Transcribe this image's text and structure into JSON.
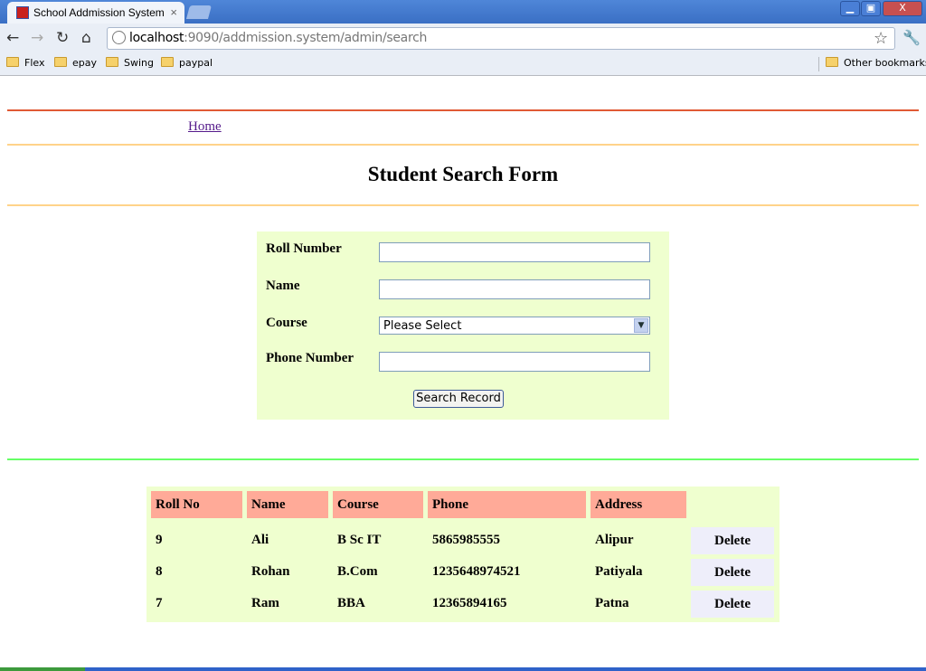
{
  "browser": {
    "tab_title": "School Addmission System",
    "tab_close": "×",
    "url_host": "localhost",
    "url_rest": ":9090/addmission.system/admin/search",
    "window_controls": {
      "minimize": "▁",
      "maximize": "▣",
      "close": "X"
    },
    "bookmarks": [
      "Flex",
      "epay",
      "Swing",
      "paypal"
    ],
    "other_bookmarks": "Other bookmarks"
  },
  "nav": {
    "home": "Home"
  },
  "page": {
    "title": "Student Search Form"
  },
  "form": {
    "roll_label": "Roll Number",
    "name_label": "Name",
    "course_label": "Course",
    "course_selected": "Please Select",
    "phone_label": "Phone Number",
    "submit_label": "Search Record"
  },
  "table": {
    "headers": [
      "Roll No",
      "Name",
      "Course",
      "Phone",
      "Address"
    ],
    "rows": [
      {
        "roll": "9",
        "name": "Ali",
        "course": "B Sc IT",
        "phone": "5865985555",
        "address": "Alipur",
        "action": "Delete"
      },
      {
        "roll": "8",
        "name": "Rohan",
        "course": "B.Com",
        "phone": "1235648974521",
        "address": "Patiyala",
        "action": "Delete"
      },
      {
        "roll": "7",
        "name": "Ram",
        "course": "BBA",
        "phone": "12365894165",
        "address": "Patna",
        "action": "Delete"
      }
    ]
  },
  "colors": {
    "accent_red": "#e05a35",
    "rule_orange": "#ffd38a",
    "rule_green": "#66ff66",
    "panel_bg": "#efffcf",
    "header_bg": "#ffaa98"
  },
  "icons": [
    "back-arrow-icon",
    "forward-arrow-icon",
    "reload-icon",
    "home-icon",
    "page-info-icon",
    "bookmark-star-icon",
    "wrench-icon",
    "folder-icon",
    "dropdown-arrow-icon"
  ]
}
